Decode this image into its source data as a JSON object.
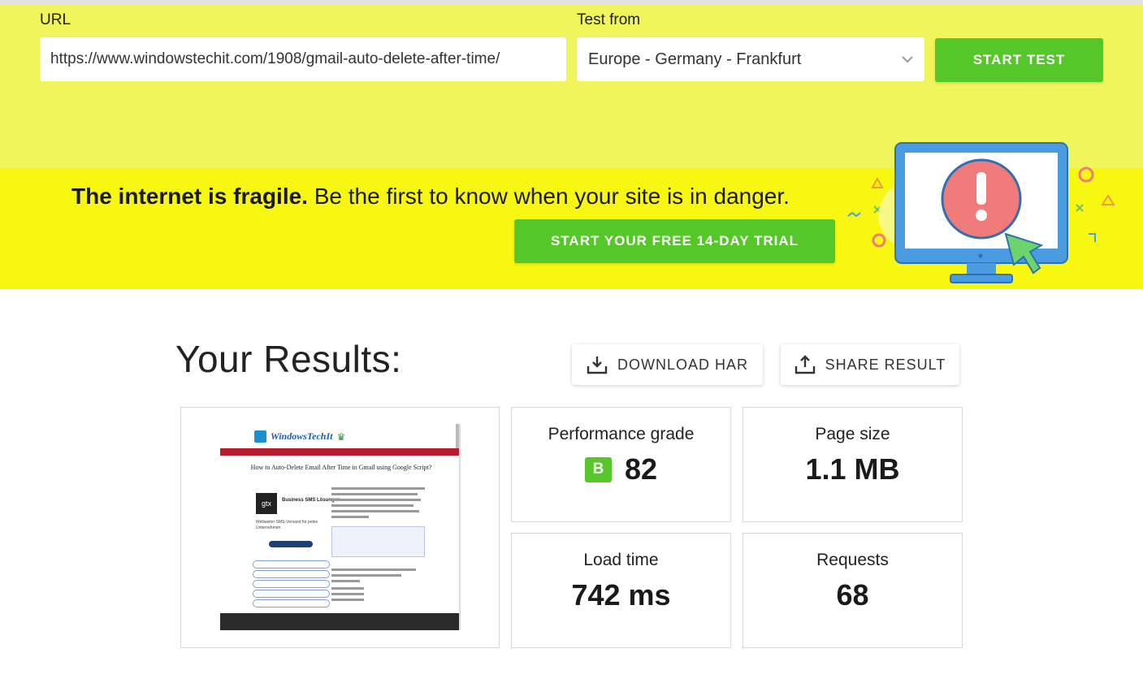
{
  "form": {
    "url_label": "URL",
    "url_value": "https://www.windowstechit.com/1908/gmail-auto-delete-after-time/",
    "test_from_label": "Test from",
    "test_from_value": "Europe - Germany - Frankfurt",
    "start_label": "START TEST"
  },
  "promo": {
    "bold_text": "The internet is fragile.",
    "text": " Be the first to know when your site is in danger.",
    "trial_label": "START YOUR FREE 14-DAY TRIAL"
  },
  "results": {
    "title": "Your Results:",
    "download_label": "DOWNLOAD HAR",
    "share_label": "SHARE RESULT",
    "performance_label": "Performance grade",
    "grade_letter": "B",
    "grade_value": "82",
    "page_size_label": "Page size",
    "page_size_value": "1.1 MB",
    "load_time_label": "Load time",
    "load_time_value": "742 ms",
    "requests_label": "Requests",
    "requests_value": "68"
  },
  "screenshot": {
    "logo_text": "WindowsTechIt",
    "headline": "How to Auto-Delete Email After Time in Gmail using Google Script?",
    "ad_brand": "gtx",
    "ad_title": "Business SMS Lösungen",
    "ad_text": "Weltweiter SMS-Versand für jedes Unternehmen."
  },
  "colors": {
    "accent_green": "#56c728",
    "form_band": "#f1f55c",
    "promo_band": "#f7f711"
  }
}
